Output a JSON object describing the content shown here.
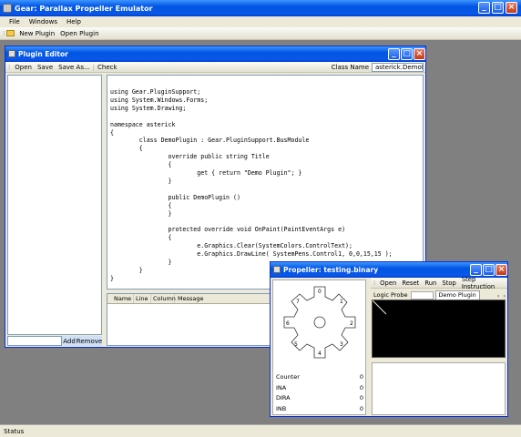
{
  "main_window": {
    "title": "Gear: Parallax Propeller Emulator",
    "menu": [
      "File",
      "Windows",
      "Help"
    ],
    "toolbar": {
      "new_plugin": "New Plugin",
      "open_plugin": "Open Plugin"
    },
    "status": "Status"
  },
  "plugin_editor": {
    "title": "Plugin Editor",
    "toolbar": {
      "open": "Open",
      "save": "Save",
      "save_as": "Save As...",
      "check": "Check",
      "class_name_label": "Class Name",
      "class_name_value": "asterick.DemoPlugir"
    },
    "add_label": "Add",
    "remove_label": "Remove",
    "code": "using Gear.PluginSupport;\nusing System.Windows.Forms;\nusing System.Drawing;\n\nnamespace asterick\n{\n        class DemoPlugin : Gear.PluginSupport.BusModule\n        {\n                override public string Title\n                {\n                        get { return \"Demo Plugin\"; }\n                }\n\n                public DemoPlugin ()\n                {\n                }\n\n                protected override void OnPaint(PaintEventArgs e)\n                {\n                        e.Graphics.Clear(SystemColors.ControlText);\n                        e.Graphics.DrawLine( SystemPens.Control1, 0,0,15,15 );\n                }\n        }\n}",
    "error_columns": [
      "Name",
      "Line",
      "Column",
      "Message"
    ]
  },
  "propeller": {
    "title": "Propeller: testing.binary",
    "toolbar": [
      "Open",
      "Reset",
      "Run",
      "Stop",
      "Step Instruction"
    ],
    "tabs": [
      "Logic Probe",
      "Demo Plugin"
    ],
    "cog_labels": [
      "0",
      "1",
      "2",
      "3",
      "4",
      "5",
      "6",
      "7"
    ],
    "registers": [
      {
        "name": "Counter",
        "value": "0"
      },
      {
        "name": "INA",
        "value": "0"
      },
      {
        "name": "DIRA",
        "value": "0"
      },
      {
        "name": "INB",
        "value": "0"
      }
    ]
  },
  "colors": {
    "titlebar": "#0054e3",
    "chrome": "#ece9d8",
    "desktop": "#808080",
    "probe_bg": "#000000"
  }
}
